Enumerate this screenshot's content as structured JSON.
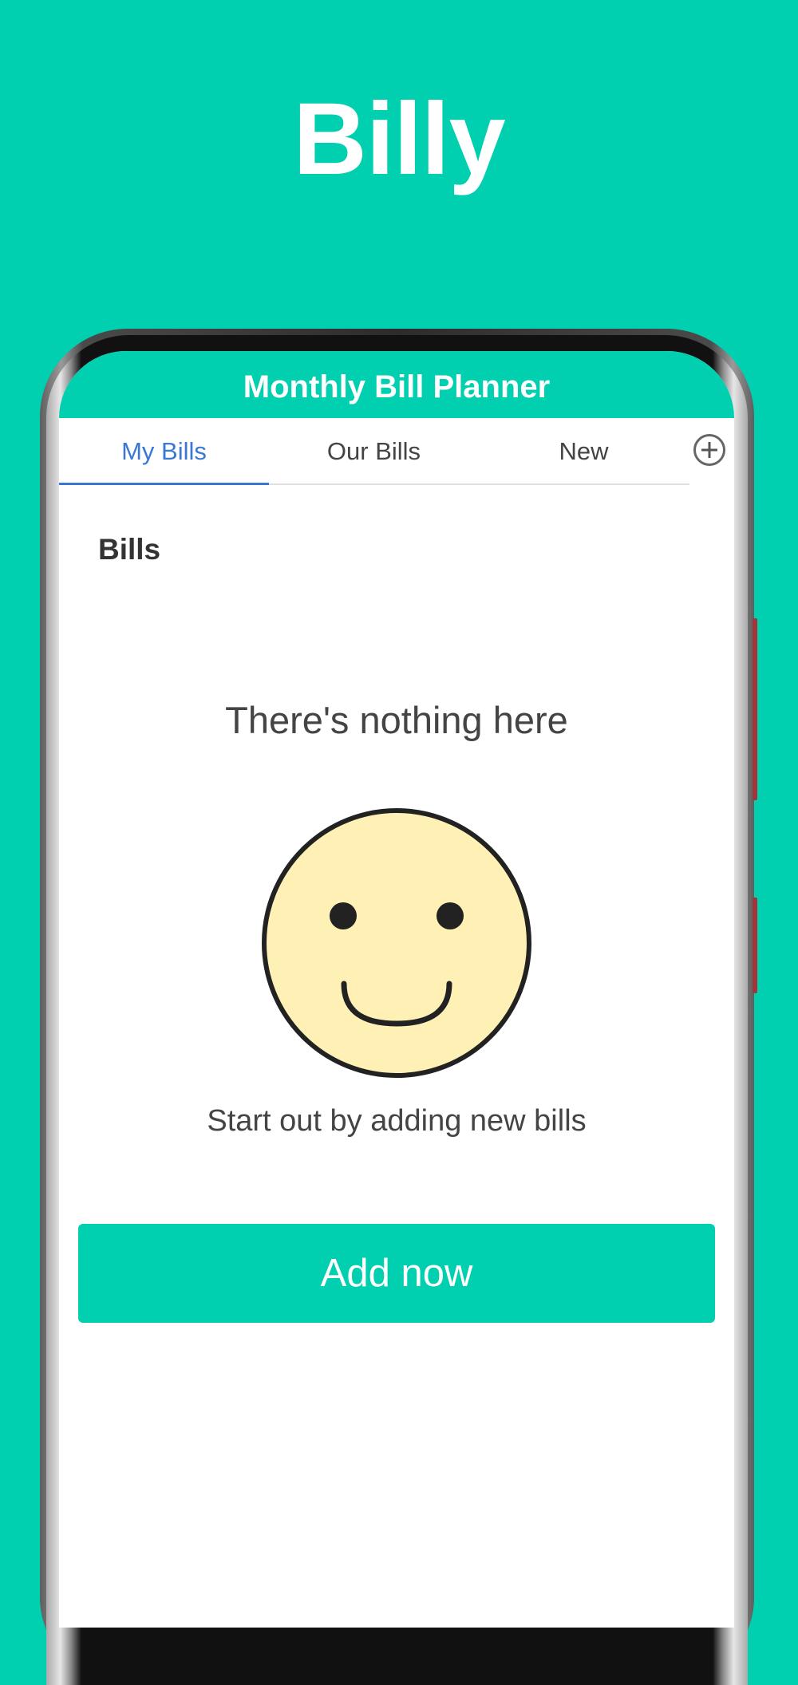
{
  "promo": {
    "title": "Billy"
  },
  "app": {
    "header_title": "Monthly Bill Planner",
    "tabs": [
      {
        "label": "My Bills",
        "active": true
      },
      {
        "label": "Our Bills",
        "active": false
      },
      {
        "label": "New",
        "active": false
      }
    ],
    "add_tab_icon": "plus-circle-icon"
  },
  "main": {
    "section_title": "Bills",
    "empty_heading": "There's nothing here",
    "illustration_icon": "smiley-face-icon",
    "empty_subtitle": "Start out by adding new bills",
    "add_button_label": "Add now"
  },
  "colors": {
    "brand": "#00cfb0",
    "active_tab": "#3a78d4",
    "smiley_fill": "#fff1b5"
  }
}
